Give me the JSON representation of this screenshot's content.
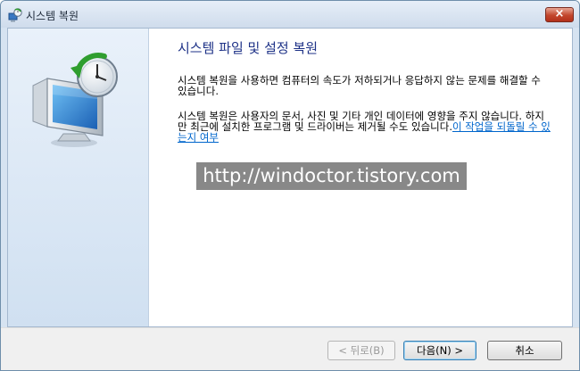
{
  "window": {
    "title": "시스템 복원",
    "close_label": "×"
  },
  "main": {
    "heading": "시스템 파일 및 설정 복원",
    "paragraph1": "시스템 복원을 사용하면 컴퓨터의 속도가 저하되거나 응답하지 않는 문제를 해결할 수 있습니다.",
    "paragraph2_text": "시스템 복원은 사용자의 문서, 사진 및 기타 개인 데이터에 영향을 주지 않습니다. 하지만 최근에 설치한 프로그램 및 드라이버는 제거될 수도 있습니다.",
    "paragraph2_link": "이 작업을 되돌릴 수 있는지 여부"
  },
  "watermark": "http://windoctor.tistory.com",
  "footer": {
    "back_label": "< 뒤로(B)",
    "next_label": "다음(N) >",
    "cancel_label": "취소"
  },
  "icons": {
    "title_icon": "system-restore-icon",
    "hero_icon": "computer-restore-clock-icon"
  }
}
